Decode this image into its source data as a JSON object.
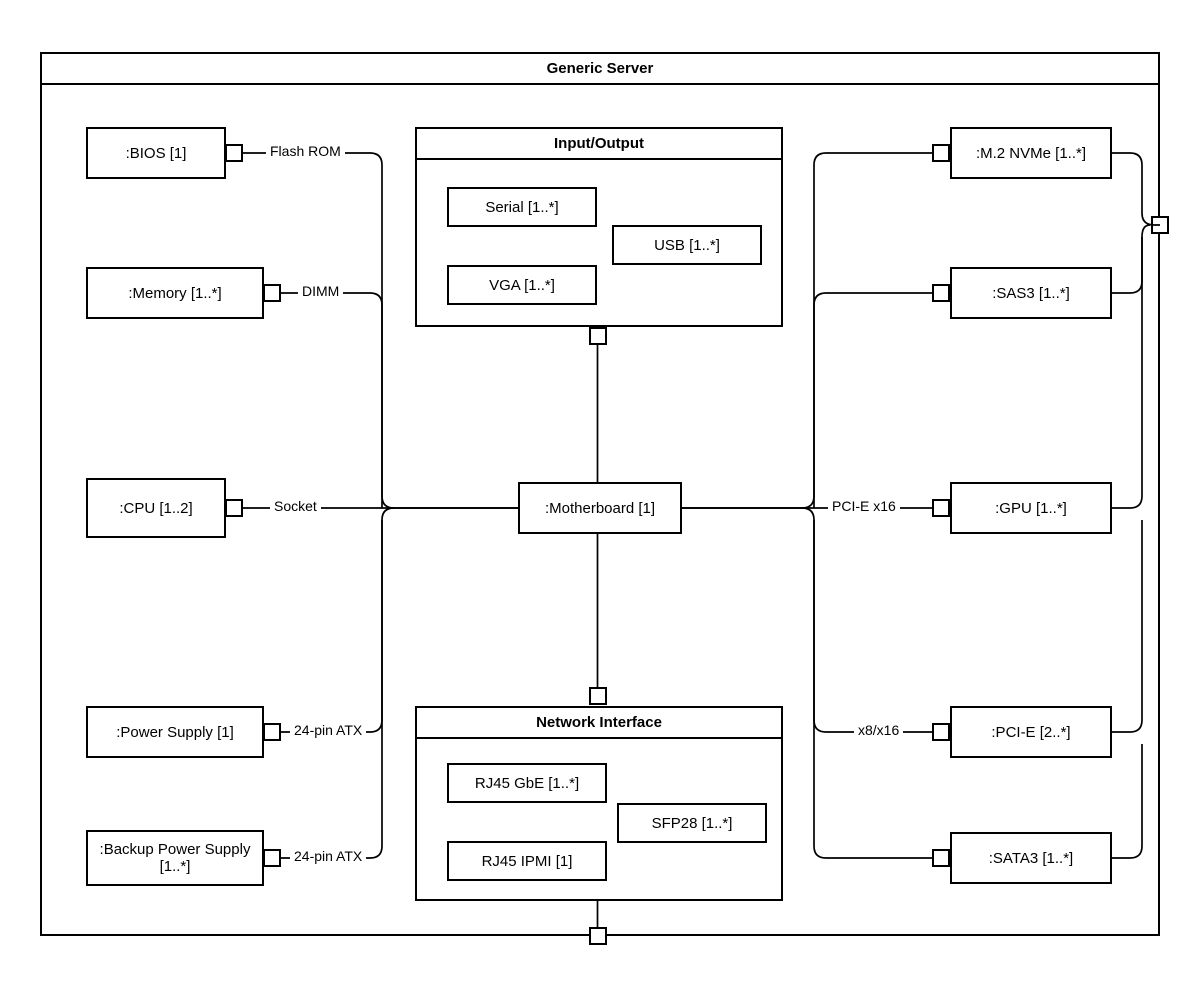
{
  "frame": {
    "title": "Generic Server"
  },
  "nodes": {
    "bios": {
      "label": ":BIOS [1]"
    },
    "memory": {
      "label": ":Memory [1..*]"
    },
    "cpu": {
      "label": ":CPU [1..2]"
    },
    "psu": {
      "label": ":Power Supply [1]"
    },
    "backup_psu": {
      "label": ":Backup Power Supply [1..*]"
    },
    "motherboard": {
      "label": ":Motherboard [1]"
    },
    "m2": {
      "label": ":M.2 NVMe [1..*]"
    },
    "sas3": {
      "label": ":SAS3 [1..*]"
    },
    "gpu": {
      "label": ":GPU [1..*]"
    },
    "pcie": {
      "label": ":PCI-E [2..*]"
    },
    "sata3": {
      "label": ":SATA3 [1..*]"
    }
  },
  "groups": {
    "io": {
      "title": "Input/Output",
      "serial": "Serial [1..*]",
      "usb": "USB [1..*]",
      "vga": "VGA [1..*]"
    },
    "net": {
      "title": "Network Interface",
      "rj45_gbe": "RJ45 GbE [1..*]",
      "sfp28": "SFP28 [1..*]",
      "rj45_ipmi": "RJ45 IPMI [1]"
    }
  },
  "edges": {
    "flash_rom": "Flash ROM",
    "dimm": "DIMM",
    "socket": "Socket",
    "atx1": "24-pin ATX",
    "atx2": "24-pin ATX",
    "pcie_x16": "PCI-E x16",
    "x8x16": "x8/x16"
  }
}
